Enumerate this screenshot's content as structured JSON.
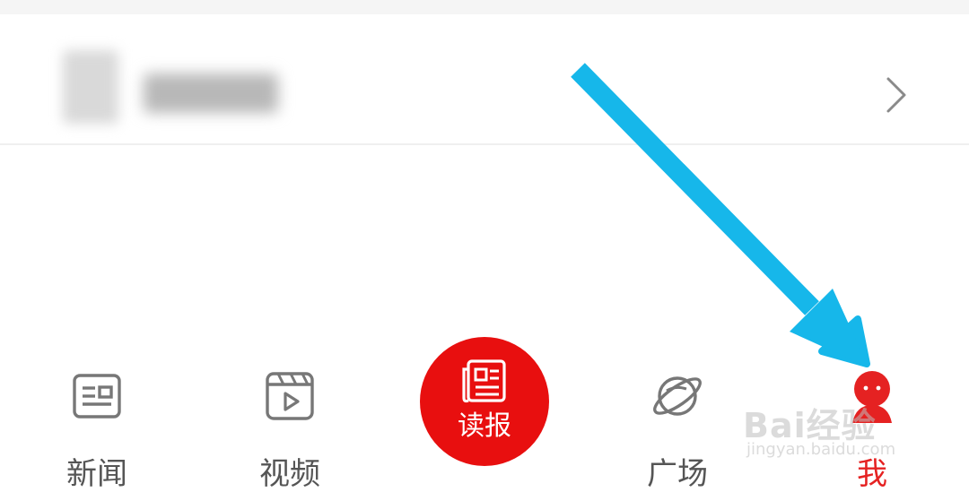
{
  "profile": {
    "name_blurred": true
  },
  "tabs": [
    {
      "id": "news",
      "label": "新闻",
      "icon": "news-icon",
      "active": false
    },
    {
      "id": "video",
      "label": "视频",
      "icon": "video-icon",
      "active": false
    },
    {
      "id": "read",
      "label": "读报",
      "icon": "newspaper-icon",
      "active": false
    },
    {
      "id": "square",
      "label": "广场",
      "icon": "planet-icon",
      "active": false
    },
    {
      "id": "me",
      "label": "我",
      "icon": "person-icon",
      "active": true
    }
  ],
  "colors": {
    "accent": "#e52222",
    "center_button": "#e80f0f",
    "arrow": "#16b7ea",
    "icon_gray": "#777777"
  },
  "watermark": {
    "text": "Bai经验",
    "sub": "jingyan.baidu.com"
  }
}
